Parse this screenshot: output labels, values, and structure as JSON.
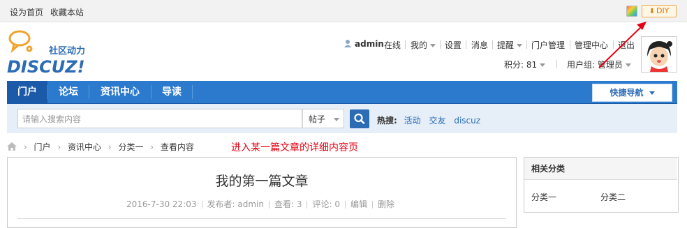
{
  "topbar": {
    "set_home": "设为首页",
    "bookmark": "收藏本站",
    "diy_label": "DIY"
  },
  "logo": {
    "tagline": "社区动力",
    "brand": "DISCUZ!"
  },
  "userbar": {
    "username": "admin",
    "status": "在线",
    "mine": "我的",
    "settings": "设置",
    "messages": "消息",
    "reminders": "提醒",
    "portal_admin": "门户管理",
    "admin_center": "管理中心",
    "logout": "退出",
    "points": "积分: 81",
    "usergroup": "用户组: 管理员"
  },
  "nav": {
    "items": [
      "门户",
      "论坛",
      "资讯中心",
      "导读"
    ],
    "active_index": 0,
    "quick_nav": "快捷导航"
  },
  "search": {
    "placeholder": "请输入搜索内容",
    "type": "帖子",
    "hot_label": "热搜:",
    "hot_keywords": [
      "活动",
      "交友",
      "discuz"
    ]
  },
  "breadcrumb": [
    "门户",
    "资讯中心",
    "分类一",
    "查看内容"
  ],
  "annotation": "进入某一篇文章的详细内容页",
  "article": {
    "title": "我的第一篇文章",
    "date": "2016-7-30 22:03",
    "author": "发布者: admin",
    "views": "查看: 3",
    "comments": "评论: 0",
    "edit": "编辑",
    "delete": "删除"
  },
  "sidebar": {
    "title": "相关分类",
    "categories": [
      "分类一",
      "分类二"
    ]
  },
  "colors": {
    "nav_blue": "#2b7acd",
    "nav_active": "#1a5aa8",
    "link_blue": "#2b6cb5",
    "annotation_red": "#e60012",
    "diy_orange": "#e07400"
  }
}
